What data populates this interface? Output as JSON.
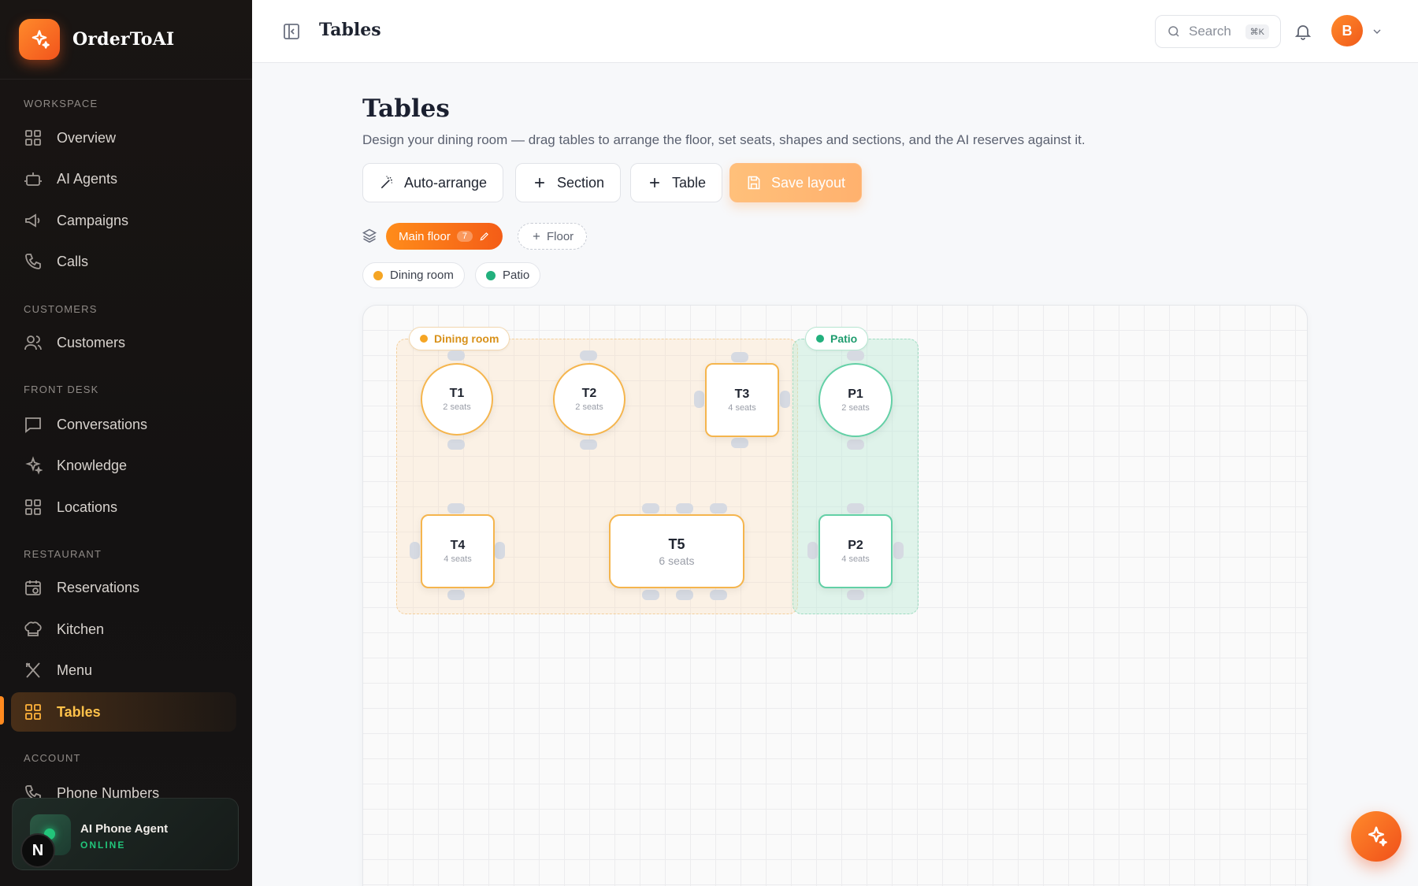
{
  "brand": {
    "name": "OrderToAI"
  },
  "sidebar": {
    "sections": {
      "workspace": "WORKSPACE",
      "customers": "CUSTOMERS",
      "front_desk": "FRONT DESK",
      "restaurant": "RESTAURANT",
      "account": "ACCOUNT"
    },
    "items": [
      {
        "label": "Overview",
        "icon": "grid-icon"
      },
      {
        "label": "AI Agents",
        "icon": "robot-icon"
      },
      {
        "label": "Campaigns",
        "icon": "megaphone-icon"
      },
      {
        "label": "Calls",
        "icon": "phone-icon"
      },
      {
        "label": "Customers",
        "icon": "users-icon"
      },
      {
        "label": "Conversations",
        "icon": "chat-icon"
      },
      {
        "label": "Knowledge",
        "icon": "sparkle-icon"
      },
      {
        "label": "Locations",
        "icon": "grid-icon"
      },
      {
        "label": "Reservations",
        "icon": "calendar-clock-icon"
      },
      {
        "label": "Kitchen",
        "icon": "chef-hat-icon"
      },
      {
        "label": "Menu",
        "icon": "utensils-icon"
      },
      {
        "label": "Tables",
        "icon": "grid-icon",
        "active": true
      },
      {
        "label": "Phone Numbers",
        "icon": "phone-icon"
      }
    ],
    "agent_card": {
      "title": "AI Phone Agent",
      "status": "ONLINE"
    },
    "badge": "N"
  },
  "topbar": {
    "title": "Tables",
    "search_label": "Search",
    "search_shortcut": "⌘K",
    "avatar_initial": "B"
  },
  "main": {
    "title": "Tables",
    "description": "Design your dining room — drag tables to arrange the floor, set seats, shapes and sections, and the AI reserves against it.",
    "actions": {
      "auto_arrange": "Auto-arrange",
      "section": "Section",
      "table": "Table",
      "save": "Save layout"
    },
    "floors": {
      "main_label": "Main floor",
      "main_count": "7",
      "add_label": "Floor"
    },
    "sections": [
      {
        "name": "Dining room",
        "color": "#f5a524"
      },
      {
        "name": "Patio",
        "color": "#22b07d"
      }
    ],
    "tables": [
      {
        "name": "T1",
        "seats": "2 seats",
        "shape": "round",
        "section": "Dining room"
      },
      {
        "name": "T2",
        "seats": "2 seats",
        "shape": "round",
        "section": "Dining room"
      },
      {
        "name": "T3",
        "seats": "4 seats",
        "shape": "square",
        "section": "Dining room"
      },
      {
        "name": "P1",
        "seats": "2 seats",
        "shape": "round",
        "section": "Patio"
      },
      {
        "name": "T4",
        "seats": "4 seats",
        "shape": "square",
        "section": "Dining room"
      },
      {
        "name": "T5",
        "seats": "6 seats",
        "shape": "rect",
        "section": "Dining room"
      },
      {
        "name": "P2",
        "seats": "4 seats",
        "shape": "square",
        "section": "Patio"
      }
    ]
  },
  "colors": {
    "accent": "#ff8a1f",
    "dining": "#f5a524",
    "patio": "#22b07d"
  }
}
